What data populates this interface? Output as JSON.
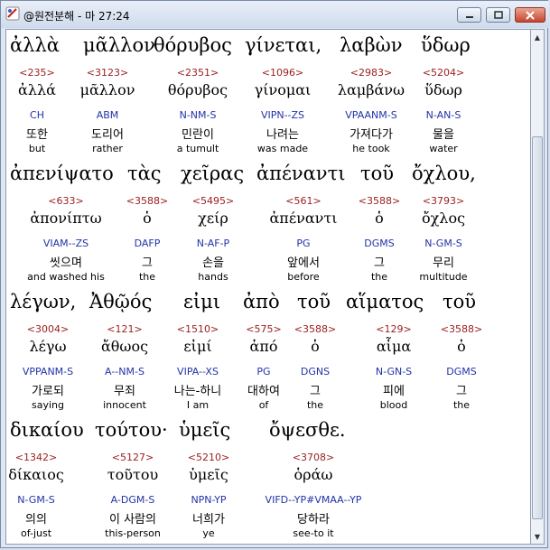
{
  "window": {
    "title": "@원전분해 - 마 27:24",
    "buttons": [
      "minimize",
      "maximize",
      "close"
    ]
  },
  "lines": [
    [
      {
        "greek": "ἀλλὰ",
        "num": "<235>",
        "lemma": "ἀλλά",
        "code": "CH",
        "kor": "또한",
        "eng": "but"
      },
      {
        "greek": "μᾶλλον",
        "num": "<3123>",
        "lemma": "μᾶλλον",
        "code": "ABM",
        "kor": "도리어",
        "eng": "rather"
      },
      {
        "greek": "θόρυβος",
        "num": "<2351>",
        "lemma": "θόρυβος",
        "code": "N-NM-S",
        "kor": "민란이",
        "eng": "a tumult"
      },
      {
        "greek": "γίνεται,",
        "num": "<1096>",
        "lemma": "γίνομαι",
        "code": "VIPN--ZS",
        "kor": "나려는",
        "eng": "was made"
      },
      {
        "greek": "λαβὼν",
        "num": "<2983>",
        "lemma": "λαμβάνω",
        "code": "VPAANM-S",
        "kor": "가져다가",
        "eng": "he took"
      },
      {
        "greek": "ὕδωρ",
        "num": "<5204>",
        "lemma": "ὕδωρ",
        "code": "N-AN-S",
        "kor": "물을",
        "eng": "water"
      }
    ],
    [
      {
        "greek": "ἀπενίψατο",
        "num": "<633>",
        "lemma": "ἀπονίπτω",
        "code": "VIAM--ZS",
        "kor": "씻으며",
        "eng": "and washed his"
      },
      {
        "greek": "τὰς",
        "num": "<3588>",
        "lemma": "ὁ",
        "code": "DAFP",
        "kor": "그",
        "eng": "the"
      },
      {
        "greek": "χεῖρας",
        "num": "<5495>",
        "lemma": "χείρ",
        "code": "N-AF-P",
        "kor": "손을",
        "eng": "hands"
      },
      {
        "greek": "ἀπέναντι",
        "num": "<561>",
        "lemma": "ἀπέναντι",
        "code": "PG",
        "kor": "앞에서",
        "eng": "before"
      },
      {
        "greek": "τοῦ",
        "num": "<3588>",
        "lemma": "ὁ",
        "code": "DGMS",
        "kor": "그",
        "eng": "the"
      },
      {
        "greek": "ὄχλου,",
        "num": "<3793>",
        "lemma": "ὄχλος",
        "code": "N-GM-S",
        "kor": "무리",
        "eng": "multitude"
      }
    ],
    [
      {
        "greek": "λέγων,",
        "num": "<3004>",
        "lemma": "λέγω",
        "code": "VPPANM-S",
        "kor": "가로되",
        "eng": "saying"
      },
      {
        "greek": "Ἀθῷός",
        "num": "<121>",
        "lemma": "ἄθωος",
        "code": "A--NM-S",
        "kor": "무죄",
        "eng": "innocent"
      },
      {
        "greek": "εἰμι",
        "num": "<1510>",
        "lemma": "εἰμί",
        "code": "VIPA--XS",
        "kor": "나는-하니",
        "eng": "I am"
      },
      {
        "greek": "ἀπὸ",
        "num": "<575>",
        "lemma": "ἀπό",
        "code": "PG",
        "kor": "대하여",
        "eng": "of"
      },
      {
        "greek": "τοῦ",
        "num": "<3588>",
        "lemma": "ὁ",
        "code": "DGNS",
        "kor": "그",
        "eng": "the"
      },
      {
        "greek": "αἵματος",
        "num": "<129>",
        "lemma": "αἷμα",
        "code": "N-GN-S",
        "kor": "피에",
        "eng": "blood"
      },
      {
        "greek": "τοῦ",
        "num": "<3588>",
        "lemma": "ὁ",
        "code": "DGMS",
        "kor": "그",
        "eng": "the"
      }
    ],
    [
      {
        "greek": "δικαίου",
        "num": "<1342>",
        "lemma": "δίκαιος",
        "code": "N-GM-S",
        "kor": "의의",
        "eng": "of-just"
      },
      {
        "greek": "τούτου·",
        "num": "<5127>",
        "lemma": "τοῦτου",
        "code": "A-DGM-S",
        "kor": "이 사람의",
        "eng": "this-person"
      },
      {
        "greek": "ὑμεῖς",
        "num": "<5210>",
        "lemma": "ὑμεῖς",
        "code": "NPN-YP",
        "kor": "너희가",
        "eng": "ye"
      },
      {
        "greek": "ὄψεσθε.",
        "num": "<3708>",
        "lemma": "ὁράω",
        "code": "VIFD--YP#VMAA--YP",
        "kor": "당하라",
        "eng": "see-to it"
      }
    ]
  ]
}
